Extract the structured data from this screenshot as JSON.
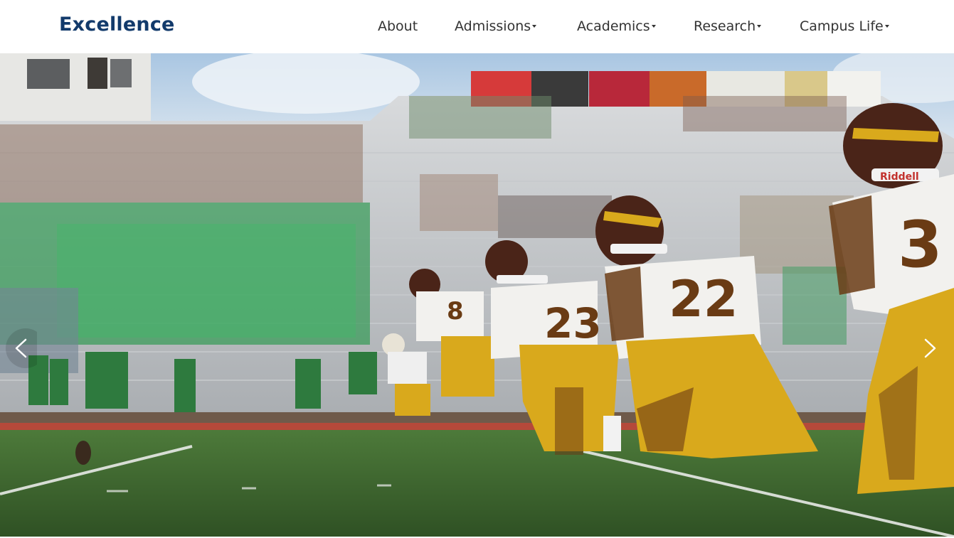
{
  "site": {
    "brand": "Excellence"
  },
  "nav": {
    "items": [
      {
        "label": "About",
        "dropdown": false
      },
      {
        "label": "Admissions",
        "dropdown": true
      },
      {
        "label": "Academics",
        "dropdown": true
      },
      {
        "label": "Research",
        "dropdown": true
      },
      {
        "label": "Campus Life",
        "dropdown": true
      }
    ]
  },
  "hero": {
    "jersey_numbers": [
      "8",
      "23",
      "22",
      "3"
    ],
    "helmet_brand": "Riddell",
    "prev_icon": "chevron-left-icon",
    "next_icon": "chevron-right-icon"
  },
  "colors": {
    "brand": "#123a6b",
    "nav_text": "#333333",
    "jersey_gold": "#d9a91c",
    "helmet_maroon": "#4a2418",
    "turf": "#3f6a2f"
  }
}
